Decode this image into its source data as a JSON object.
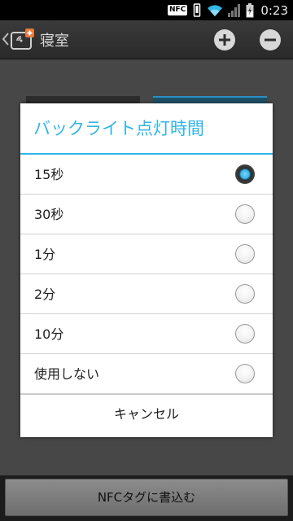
{
  "status_bar": {
    "nfc_badge": "NFC",
    "time": "0:23"
  },
  "action_bar": {
    "title": "寝室",
    "icons": {
      "back": "chevron-left-icon",
      "app": "nfc-tag-icon",
      "add": "add-circle-icon",
      "remove": "remove-circle-icon"
    }
  },
  "dialog": {
    "title": "バックライト点灯時間",
    "options": [
      {
        "label": "15秒",
        "selected": true
      },
      {
        "label": "30秒",
        "selected": false
      },
      {
        "label": "1分",
        "selected": false
      },
      {
        "label": "2分",
        "selected": false
      },
      {
        "label": "10分",
        "selected": false
      },
      {
        "label": "使用しない",
        "selected": false
      }
    ],
    "cancel_label": "キャンセル"
  },
  "bottom": {
    "write_button_label": "NFCタグに書込む"
  },
  "colors": {
    "accent": "#33b5e5"
  }
}
